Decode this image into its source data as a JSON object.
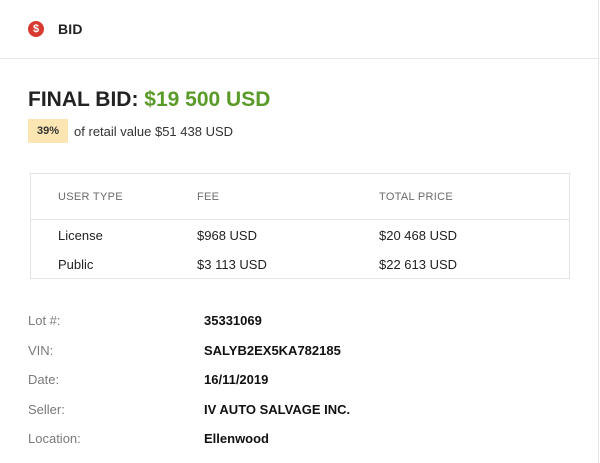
{
  "header": {
    "icon": "dollar-icon",
    "icon_glyph": "$",
    "icon_color": "#d93a30",
    "title": "BID"
  },
  "final_bid": {
    "label": "FINAL BID:",
    "amount": "$19 500 USD",
    "amount_color": "#5a9a28"
  },
  "retail": {
    "percent": "39%",
    "text": "of retail value $51 438 USD"
  },
  "fee_table": {
    "columns": [
      "USER TYPE",
      "FEE",
      "TOTAL PRICE"
    ],
    "rows": [
      [
        "License",
        "$968 USD",
        "$20 468 USD"
      ],
      [
        "Public",
        "$3 113 USD",
        "$22 613 USD"
      ]
    ]
  },
  "details": [
    {
      "label": "Lot #:",
      "value": "35331069"
    },
    {
      "label": "VIN:",
      "value": "SALYB2EX5KA782185"
    },
    {
      "label": "Date:",
      "value": "16/11/2019"
    },
    {
      "label": "Seller:",
      "value": "IV AUTO SALVAGE INC."
    },
    {
      "label": "Location:",
      "value": "Ellenwood"
    }
  ]
}
